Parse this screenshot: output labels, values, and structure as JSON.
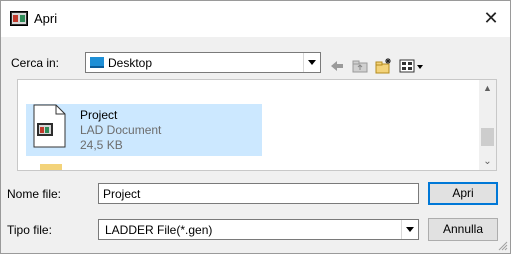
{
  "window": {
    "title": "Apri",
    "close_glyph": "✕",
    "app_icon": "ladder-app-icon"
  },
  "look_in": {
    "label": "Cerca in:",
    "value": "Desktop",
    "icon": "desktop-icon"
  },
  "toolbar": {
    "icons": [
      "back-arrow-icon",
      "up-folder-icon",
      "new-folder-icon",
      "view-menu-icon"
    ]
  },
  "file_list": {
    "items": [
      {
        "name": "Project",
        "type": "LAD Document",
        "size": "24,5 KB",
        "selected": true,
        "icon": "lad-document-icon"
      }
    ],
    "scroll_up_glyph": "▲",
    "scroll_down_glyph": "⌄"
  },
  "file_name": {
    "label": "Nome file:",
    "value": "Project"
  },
  "file_type": {
    "label": "Tipo file:",
    "value": "LADDER File(*.gen)"
  },
  "buttons": {
    "open": "Apri",
    "cancel": "Annulla"
  },
  "colors": {
    "selection": "#cce8ff",
    "default_button_border": "#0078d7",
    "dialog_background": "#f0f0f0"
  }
}
